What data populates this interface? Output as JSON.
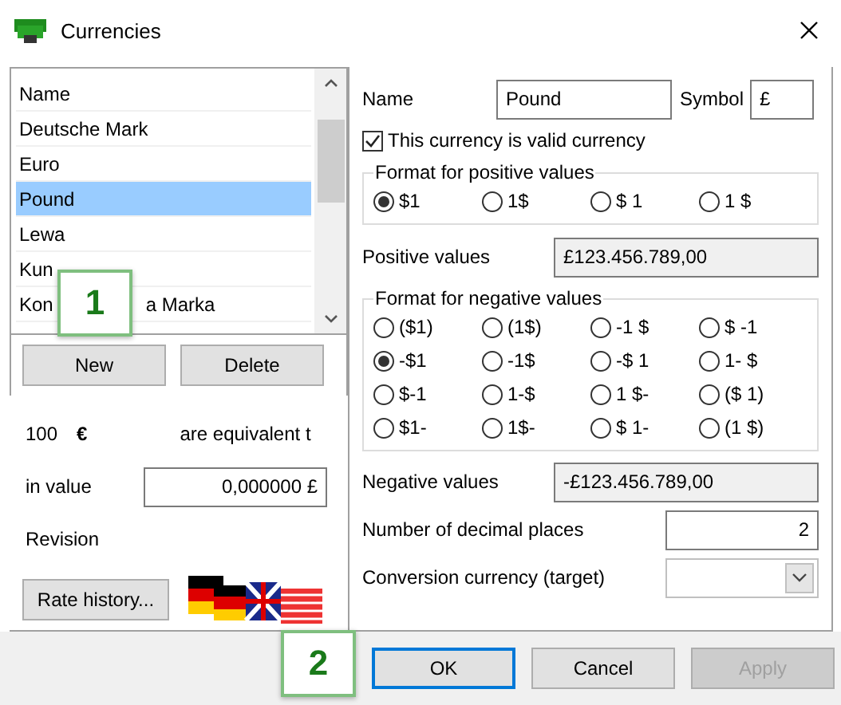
{
  "window": {
    "title": "Currencies"
  },
  "currency_list": {
    "header": "Name",
    "items": [
      {
        "label": "Deutsche Mark",
        "selected": false
      },
      {
        "label": "Euro",
        "selected": false
      },
      {
        "label": "Pound",
        "selected": true
      },
      {
        "label": "Lewa",
        "selected": false
      },
      {
        "label": "Kun",
        "selected": false
      },
      {
        "label": "Kon",
        "label_end": "a Marka",
        "selected": false
      }
    ]
  },
  "callouts": [
    {
      "label": "1"
    },
    {
      "label": "2"
    }
  ],
  "list_buttons": [
    "New",
    "Delete"
  ],
  "conversion": {
    "amount": "100",
    "symbol": "€",
    "equivalent_label": "are equivalent t",
    "value_label": "in value",
    "value": "0,000000 £",
    "revision_label": "Revision",
    "history_button": "Rate history..."
  },
  "details": {
    "name_label": "Name",
    "name": "Pound",
    "symbol_label": "Symbol",
    "symbol": "£",
    "valid": {
      "label": "This currency is valid currency",
      "checked": true
    },
    "positive_group": {
      "title": "Format for positive values",
      "options": [
        {
          "label": "$1",
          "selected": true
        },
        {
          "label": "1$",
          "selected": false
        },
        {
          "label": "$ 1",
          "selected": false
        },
        {
          "label": "1 $",
          "selected": false
        }
      ]
    },
    "positive_label": "Positive values",
    "positive_value": "£123.456.789,00",
    "negative_group": {
      "title": "Format for negative values",
      "options": [
        {
          "label": "($1)",
          "selected": false
        },
        {
          "label": "(1$)",
          "selected": false
        },
        {
          "label": "-1 $",
          "selected": false
        },
        {
          "label": "$ -1",
          "selected": false
        },
        {
          "label": "-$1",
          "selected": true
        },
        {
          "label": "-1$",
          "selected": false
        },
        {
          "label": "-$ 1",
          "selected": false
        },
        {
          "label": "1- $",
          "selected": false
        },
        {
          "label": "$-1",
          "selected": false
        },
        {
          "label": "1-$",
          "selected": false
        },
        {
          "label": "1 $-",
          "selected": false
        },
        {
          "label": "($ 1)",
          "selected": false
        },
        {
          "label": "$1-",
          "selected": false
        },
        {
          "label": "1$-",
          "selected": false
        },
        {
          "label": "$ 1-",
          "selected": false
        },
        {
          "label": "(1 $)",
          "selected": false
        }
      ]
    },
    "negative_label": "Negative values",
    "negative_value": "-£123.456.789,00",
    "decimals_label": "Number of decimal places",
    "decimals": "2",
    "target_label": "Conversion currency (target)"
  },
  "buttons": [
    {
      "label": "OK",
      "default": true,
      "disabled": false
    },
    {
      "label": "Cancel",
      "default": false,
      "disabled": false
    },
    {
      "label": "Apply",
      "default": false,
      "disabled": true
    }
  ]
}
